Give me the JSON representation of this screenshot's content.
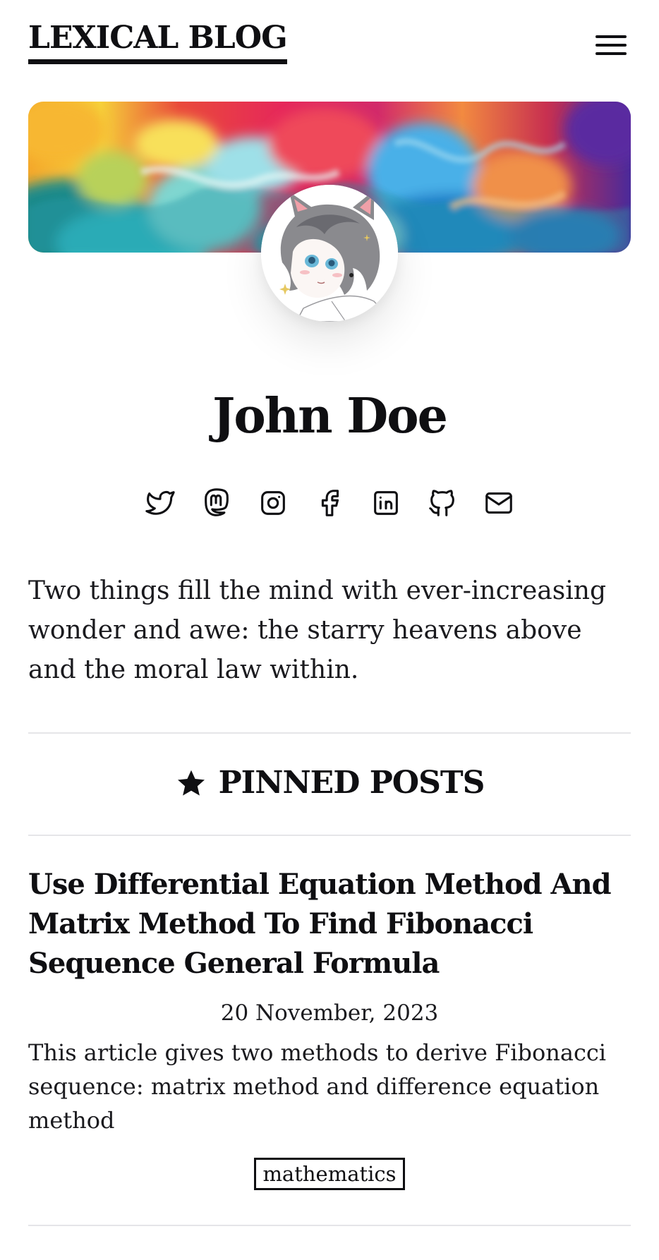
{
  "header": {
    "site_title": "LEXICAL BLOG",
    "menu_icon": "hamburger-menu-icon"
  },
  "banner": {
    "description_icon": "colorful-smoke-banner"
  },
  "profile": {
    "avatar_icon": "anime-avatar",
    "name": "John Doe",
    "bio": "Two things fill the mind with ever-increasing wonder and awe: the starry heavens above and the moral law within."
  },
  "socials": [
    {
      "name": "twitter-icon"
    },
    {
      "name": "mastodon-icon"
    },
    {
      "name": "instagram-icon"
    },
    {
      "name": "facebook-icon"
    },
    {
      "name": "linkedin-icon"
    },
    {
      "name": "github-icon"
    },
    {
      "name": "mail-icon"
    }
  ],
  "pinned": {
    "icon": "star-icon",
    "title": "PINNED POSTS"
  },
  "posts": [
    {
      "title": "Use Differential Equation Method And Matrix Method To Find Fibonacci Sequence General Formula",
      "date": "20 November, 2023",
      "description": "This article gives two methods to derive Fibonacci sequence: matrix method and difference equation method",
      "tag": "mathematics"
    }
  ],
  "colors": {
    "text": "#0f0f12",
    "divider": "#e5e5e8",
    "background": "#ffffff"
  }
}
